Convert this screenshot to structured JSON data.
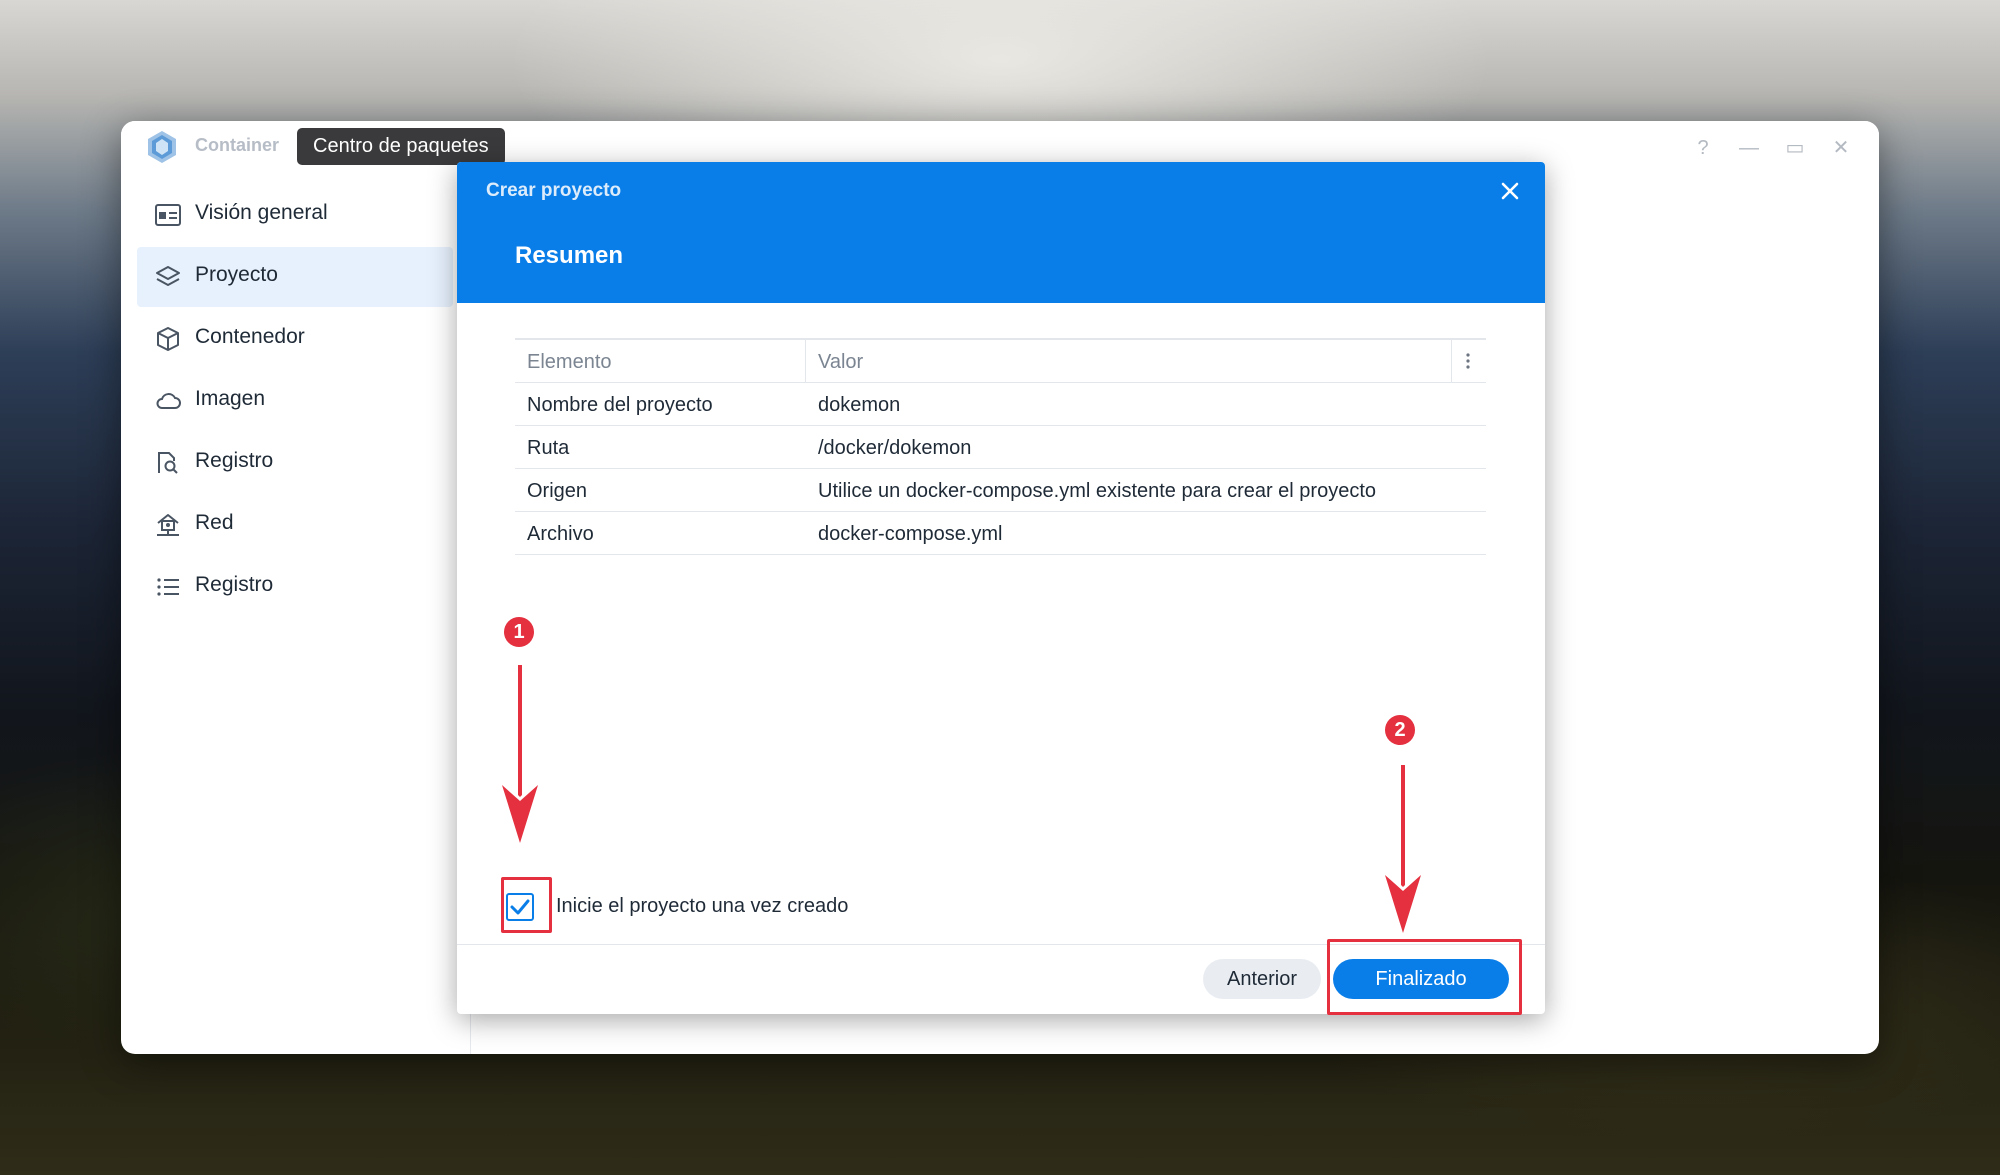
{
  "window": {
    "app_title": "Container",
    "tooltip": "Centro de paquetes",
    "controls": [
      "?",
      "—",
      "▭",
      "✕"
    ]
  },
  "sidebar": {
    "items": [
      {
        "label": "Visión general",
        "icon": "overview-icon",
        "active": false
      },
      {
        "label": "Proyecto",
        "icon": "layers-icon",
        "active": true
      },
      {
        "label": "Contenedor",
        "icon": "cube-icon",
        "active": false
      },
      {
        "label": "Imagen",
        "icon": "cloud-icon",
        "active": false
      },
      {
        "label": "Registro",
        "icon": "registry-search-icon",
        "active": false
      },
      {
        "label": "Red",
        "icon": "network-icon",
        "active": false
      },
      {
        "label": "Registro",
        "icon": "list-icon",
        "active": false
      }
    ]
  },
  "dialog": {
    "title": "Crear proyecto",
    "subtitle": "Resumen",
    "table": {
      "headers": [
        "Elemento",
        "Valor"
      ],
      "rows": [
        [
          "Nombre del proyecto",
          "dokemon"
        ],
        [
          "Ruta",
          "/docker/dokemon"
        ],
        [
          "Origen",
          "Utilice un docker-compose.yml existente para crear el proyecto"
        ],
        [
          "Archivo",
          "docker-compose.yml"
        ]
      ]
    },
    "checkbox": {
      "label": "Inicie el proyecto una vez creado",
      "checked": true
    },
    "buttons": {
      "previous": "Anterior",
      "finish": "Finalizado"
    }
  },
  "annotations": {
    "badge1": "1",
    "badge2": "2",
    "color": "#e4303f"
  },
  "colors": {
    "accent": "#0a7ee8",
    "sidebar_active_bg": "#e7f1fd"
  }
}
